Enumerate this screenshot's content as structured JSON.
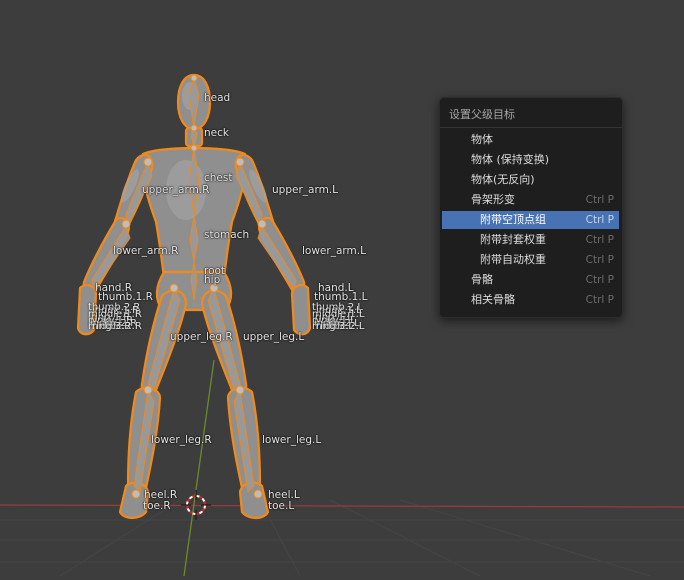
{
  "viewport": {
    "bones": {
      "head": "head",
      "neck": "neck",
      "chest": "chest",
      "upper_arm_r": "upper_arm.R",
      "upper_arm_l": "upper_arm.L",
      "lower_arm_r": "lower_arm.R",
      "lower_arm_l": "lower_arm.L",
      "stomach": "stomach",
      "root": "root",
      "hip": "hip",
      "hand_r": "hand.R",
      "hand_l": "hand.L",
      "thumb_1_r": "thumb.1.R",
      "thumb_1_l": "thumb.1.L",
      "upper_leg_r": "upper_leg.R",
      "upper_leg_l": "upper_leg.L",
      "lower_leg_r": "lower_leg.R",
      "lower_leg_l": "lower_leg.L",
      "heel_r": "heel.R",
      "heel_l": "heel.L",
      "toe_r": "toe.R",
      "toe_l": "toe.L"
    },
    "finger_labels_r": [
      "thumb.2.R",
      "index.1.R",
      "middle.1.R",
      "ring.1.R",
      "pinky.1.R",
      "index.2.R",
      "middle.2.R",
      "ring.3.R"
    ],
    "finger_labels_l": [
      "thumb.2.L",
      "index.1.L",
      "middle.1.L",
      "ring.1.L",
      "pinky.1.L",
      "index.2.L",
      "middle.2.L",
      "ring.3.L"
    ],
    "colors": {
      "background": "#3d3d3d",
      "bone_outline": "#f28a1a",
      "mesh": "#8f8f8f",
      "axis_red": "#9a3a3a",
      "axis_green": "#6b8a2a"
    }
  },
  "menu": {
    "title": "设置父级目标",
    "items": [
      {
        "label": "物体",
        "shortcut": ""
      },
      {
        "label": "物体 (保持变换)",
        "shortcut": ""
      },
      {
        "label": "物体(无反向)",
        "shortcut": ""
      },
      {
        "label": "骨架形变",
        "shortcut": "Ctrl P"
      },
      {
        "label": "附带空顶点组",
        "shortcut": "Ctrl P"
      },
      {
        "label": "附带封套权重",
        "shortcut": "Ctrl P"
      },
      {
        "label": "附带自动权重",
        "shortcut": "Ctrl P"
      },
      {
        "label": "骨骼",
        "shortcut": "Ctrl P"
      },
      {
        "label": "相关骨骼",
        "shortcut": "Ctrl P"
      }
    ],
    "highlight_color": "#4772b3"
  }
}
